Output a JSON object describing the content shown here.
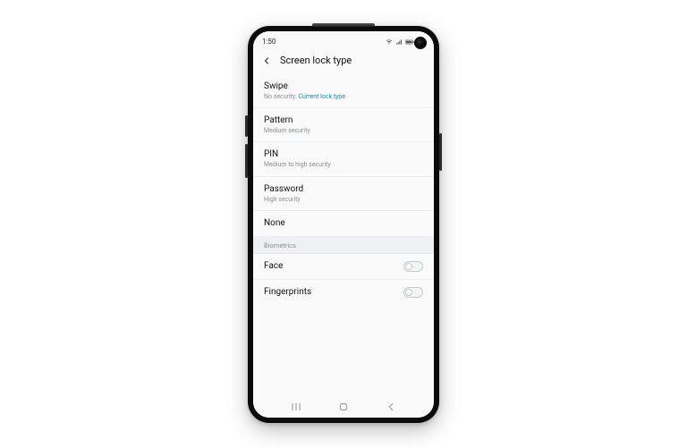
{
  "status": {
    "time": "1:50"
  },
  "header": {
    "title": "Screen lock type"
  },
  "items": {
    "swipe": {
      "title": "Swipe",
      "sub_plain": "No security.",
      "sub_hl": "Current lock type"
    },
    "pattern": {
      "title": "Pattern",
      "sub": "Medium security"
    },
    "pin": {
      "title": "PIN",
      "sub": "Medium to high security"
    },
    "password": {
      "title": "Password",
      "sub": "High security"
    },
    "none": {
      "title": "None"
    }
  },
  "section_biometrics": "Biometrics",
  "biometrics": {
    "face": {
      "title": "Face"
    },
    "fingerprints": {
      "title": "Fingerprints"
    }
  }
}
